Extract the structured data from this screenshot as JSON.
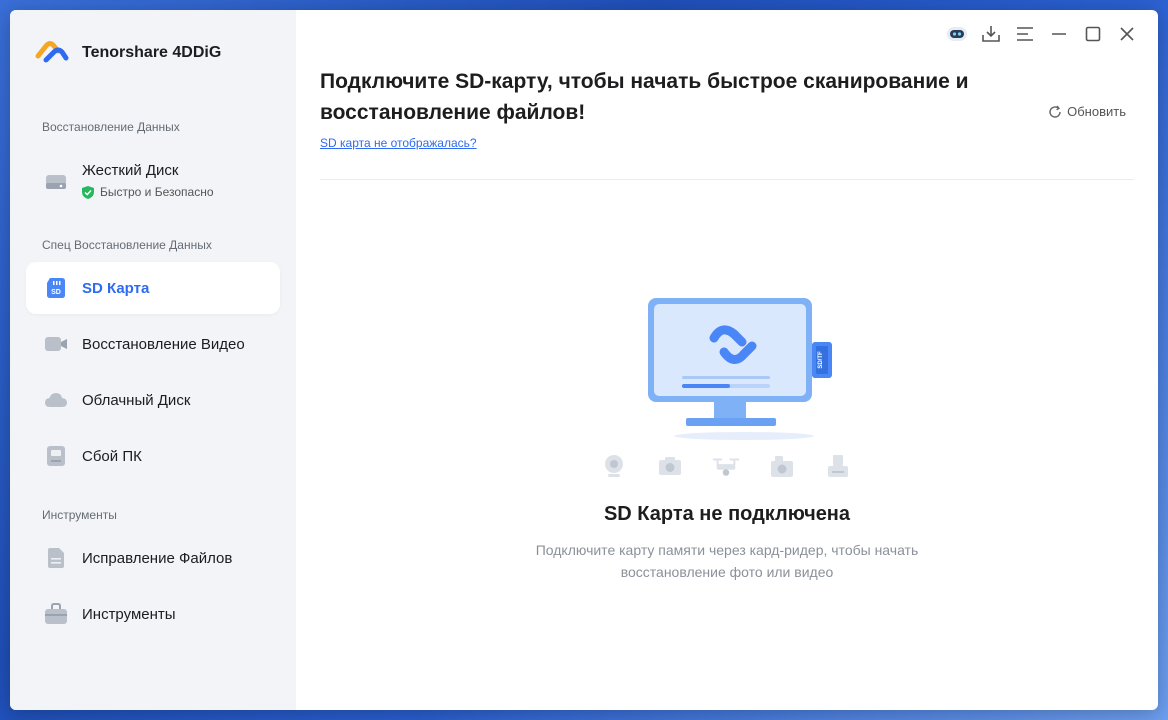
{
  "app": {
    "name": "Tenorshare 4DDiG"
  },
  "sidebar": {
    "sections": [
      {
        "label": "Восстановление Данных"
      },
      {
        "label": "Спец Восстановление Данных"
      },
      {
        "label": "Инструменты"
      }
    ],
    "hard_disk": {
      "label": "Жесткий Диск",
      "sub": "Быстро и Безопасно"
    },
    "items": [
      {
        "label": "SD Карта",
        "icon": "sd-card-icon",
        "active": true
      },
      {
        "label": "Восстановление Видео",
        "icon": "video-icon"
      },
      {
        "label": "Облачный Диск",
        "icon": "cloud-icon"
      },
      {
        "label": "Сбой ПК",
        "icon": "pc-crash-icon"
      },
      {
        "label": "Исправление Файлов",
        "icon": "file-repair-icon"
      },
      {
        "label": "Инструменты",
        "icon": "toolbox-icon"
      }
    ]
  },
  "main": {
    "headline": "Подключите SD-карту, чтобы начать быстрое сканирование и восстановление файлов!",
    "refresh_label": "Обновить",
    "help_link": "SD карта не отображалась?",
    "empty_title": "SD Карта не подключена",
    "empty_desc": "Подключите карту памяти через кард-ридер, чтобы начать восстановление фото или видео",
    "card_label": "SD/TF"
  },
  "colors": {
    "accent": "#2f6bf0",
    "sidebar_bg": "#f2f4f7",
    "muted": "#8b9099"
  }
}
